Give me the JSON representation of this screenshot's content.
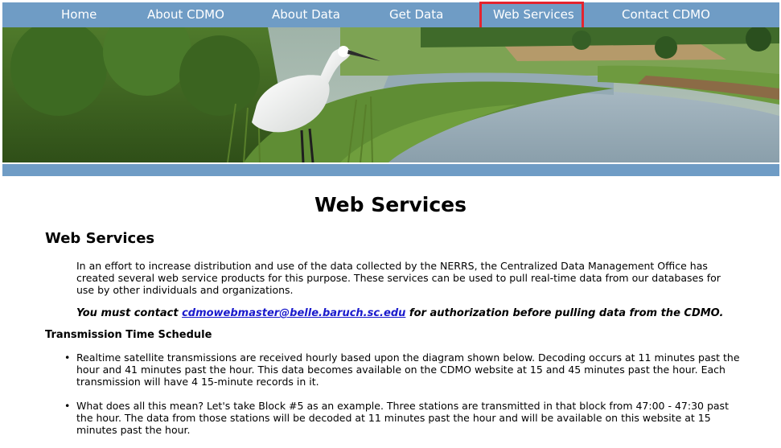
{
  "nav": {
    "items": [
      {
        "label": "Home"
      },
      {
        "label": "About CDMO"
      },
      {
        "label": "About Data"
      },
      {
        "label": "Get Data"
      },
      {
        "label": "Web Services"
      },
      {
        "label": "Contact CDMO"
      }
    ],
    "active": "Web Services"
  },
  "page": {
    "title": "Web Services",
    "section_title": "Web Services",
    "intro": "In an effort to increase distribution and use of the data collected by the NERRS, the Centralized Data Management Office has created several web service products for this purpose. These services can be used to pull real-time data from our databases for use by other individuals and organizations.",
    "notice_prefix": "You must contact ",
    "notice_email": "cdmowebmaster@belle.baruch.sc.edu",
    "notice_suffix": " for authorization before pulling data from the CDMO.",
    "schedule_title": "Transmission Time Schedule",
    "bullets": [
      "Realtime satellite transmissions are received hourly based upon the diagram shown below. Decoding occurs at 11 minutes past the hour and 41 minutes past the hour. This data becomes available on the CDMO website at 15 and 45 minutes past the hour. Each transmission will have 4 15-minute records in it.",
      "What does all this mean? Let's take Block #5 as an example. Three stations are transmitted in that block from 47:00 - 47:30 past the hour. The data from those stations will be decoded at 11 minutes past the hour and will be available on this website at 15 minutes past the hour."
    ]
  },
  "colors": {
    "nav_bg": "#6f9cc5",
    "highlight": "#e4232e",
    "link": "#1a1acc"
  }
}
